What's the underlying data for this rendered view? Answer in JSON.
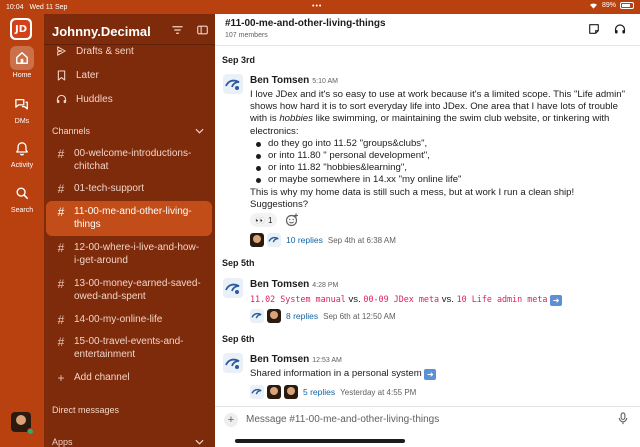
{
  "status_bar": {
    "time": "10:04",
    "date": "Wed 11 Sep",
    "battery": "89%"
  },
  "rail": {
    "items": [
      {
        "label": "Home",
        "icon": "home-icon",
        "active": true
      },
      {
        "label": "DMs",
        "icon": "dms-icon"
      },
      {
        "label": "Activity",
        "icon": "bell-icon"
      },
      {
        "label": "Search",
        "icon": "search-icon"
      }
    ],
    "accent": "#b8410f"
  },
  "sidebar": {
    "workspace": "Johnny.Decimal",
    "nav": [
      {
        "label": "Drafts & sent",
        "icon": "send-icon"
      },
      {
        "label": "Later",
        "icon": "bookmark-icon"
      },
      {
        "label": "Huddles",
        "icon": "headphones-icon"
      }
    ],
    "channels_label": "Channels",
    "channels": [
      {
        "name": "00-welcome-introductions-chitchat",
        "lines": [
          "00-welcome-introductions-",
          "chitchat"
        ]
      },
      {
        "name": "01-tech-support",
        "lines": [
          "01-tech-support"
        ]
      },
      {
        "name": "11-00-me-and-other-living-things",
        "lines": [
          "11-00-me-and-other-living-",
          "things"
        ],
        "active": true
      },
      {
        "name": "12-00-where-i-live-and-how-i-get-around",
        "lines": [
          "12-00-where-i-live-and-how-",
          "i-get-around"
        ]
      },
      {
        "name": "13-00-money-earned-saved-owed-and-spent",
        "lines": [
          "13-00-money-earned-saved-",
          "owed-and-spent"
        ]
      },
      {
        "name": "14-00-my-online-life",
        "lines": [
          "14-00-my-online-life"
        ]
      },
      {
        "name": "15-00-travel-events-and-entertainment",
        "lines": [
          "15-00-travel-events-and-",
          "entertainment"
        ]
      }
    ],
    "add_channel": "Add channel",
    "direct_messages_label": "Direct messages",
    "apps_label": "Apps",
    "bg": "#7e2b0c",
    "active_bg": "#c24d18"
  },
  "channel": {
    "title": "#11-00-me-and-other-living-things",
    "members": "107 members"
  },
  "messages": [
    {
      "date": "Sep 3rd",
      "sender": "Ben Tomsen",
      "time": "5:10 AM",
      "intro_a": "I love JDex and it's so easy to use at work because it's a limited scope. This \"Life admin\" shows how hard it is to sort everyday life into JDex. One area that I have lots of trouble with is ",
      "intro_em": "hobbies",
      "intro_b": " like swimming, or maintaining the swim club website, or tinkering with electronics:",
      "bullets": [
        "do they go into 11.52 \"groups&clubs\",",
        "or into 11.80 \" personal development\",",
        "or into 11.82 \"hobbies&learning\",",
        "or maybe somewhere in 14.xx \"my online life\""
      ],
      "outro_1": "This is why my home data is still such a mess, but at work I run a clean ship!",
      "outro_2": "Suggestions?",
      "reaction": {
        "emoji": "👀",
        "count": "1"
      },
      "replies": "10 replies",
      "reply_meta": "Sep 4th at 6:38 AM"
    },
    {
      "date": "Sep 5th",
      "sender": "Ben Tomsen",
      "time": "4:28 PM",
      "code1": "11.02 System manual",
      "vs1": " vs. ",
      "code2": "00-09 JDex meta",
      "vs2": " vs. ",
      "code3": "10 Life admin meta",
      "replies": "8 replies",
      "reply_meta": "Sep 6th at 12:50 AM"
    },
    {
      "date": "Sep 6th",
      "sender": "Ben Tomsen",
      "time": "12:53 AM",
      "text": "Shared information in a personal system",
      "replies": "5 replies",
      "reply_meta": "Yesterday at 4:55 PM"
    }
  ],
  "composer": {
    "placeholder": "Message #11-00-me-and-other-living-things"
  }
}
